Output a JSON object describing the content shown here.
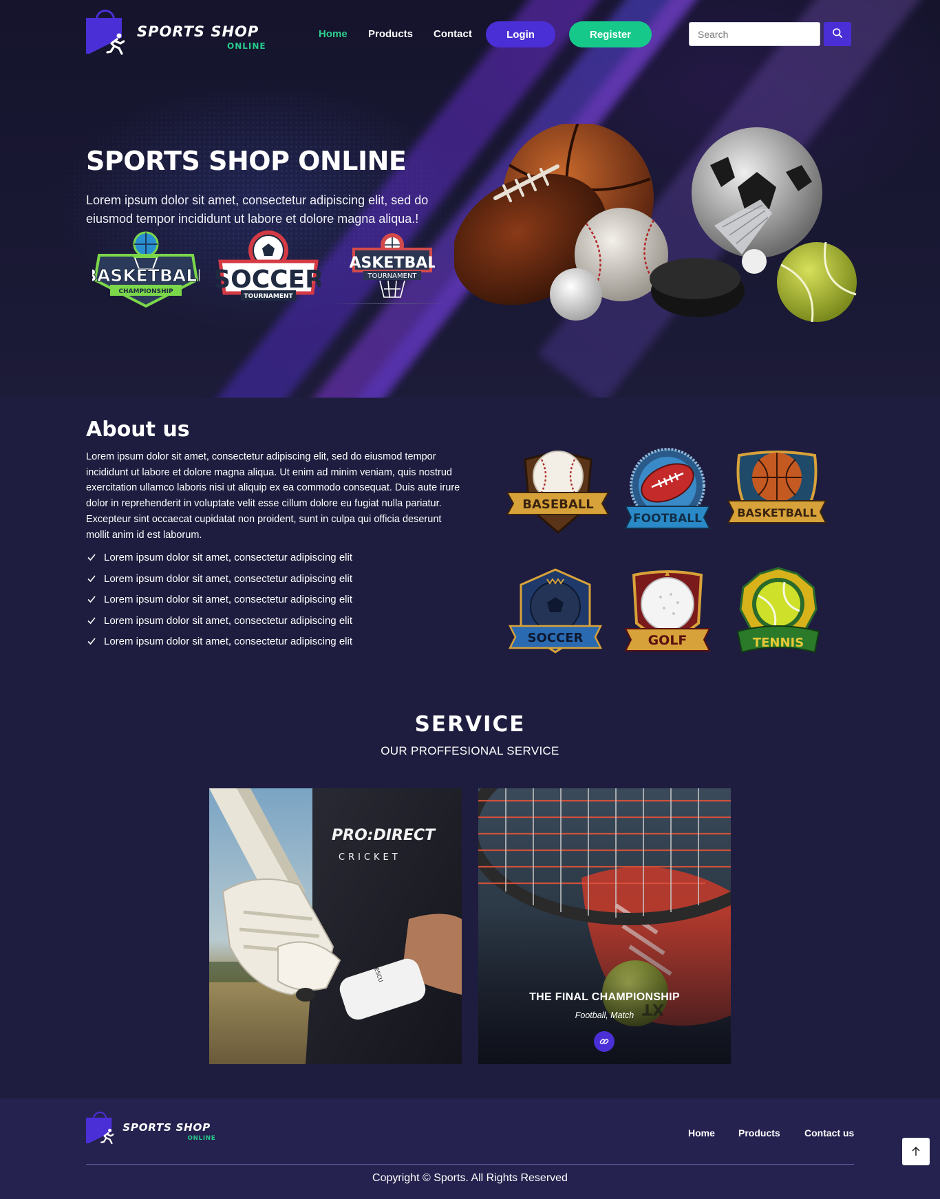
{
  "brand": {
    "name": "SPORTS SHOP",
    "tagline": "ONLINE",
    "accent_color": "#4b2fd6",
    "green_color": "#16c98a",
    "icon": "shopping-bag-runner-icon"
  },
  "nav": {
    "items": [
      {
        "label": "Home",
        "active": true
      },
      {
        "label": "Products",
        "active": false
      },
      {
        "label": "Contact",
        "active": false
      }
    ],
    "login_label": "Login",
    "register_label": "Register",
    "search_placeholder": "Search",
    "search_icon": "search-icon"
  },
  "hero": {
    "title": "SPORTS SHOP ONLINE",
    "text": "Lorem ipsum dolor sit amet, consectetur adipiscing elit, sed do eiusmod tempor incididunt ut labore et dolore magna aliqua.!",
    "logos": [
      {
        "big": "BASKETBALL",
        "small": "CHAMPIONSHIP"
      },
      {
        "big": "SOCCER",
        "small": "TOURNAMENT"
      },
      {
        "big": "BASKETBALL",
        "small": "TOURNAMENT"
      }
    ]
  },
  "about": {
    "title": "About us",
    "text": "Lorem ipsum dolor sit amet, consectetur adipiscing elit, sed do eiusmod tempor incididunt ut labore et dolore magna aliqua. Ut enim ad minim veniam, quis nostrud exercitation ullamco laboris nisi ut aliquip ex ea commodo consequat. Duis aute irure dolor in reprehenderit in voluptate velit esse cillum dolore eu fugiat nulla pariatur. Excepteur sint occaecat cupidatat non proident, sunt in culpa qui officia deserunt mollit anim id est laborum.",
    "checklist": [
      "Lorem ipsum dolor sit amet, consectetur adipiscing elit",
      "Lorem ipsum dolor sit amet, consectetur adipiscing elit",
      "Lorem ipsum dolor sit amet, consectetur adipiscing elit",
      "Lorem ipsum dolor sit amet, consectetur adipiscing elit",
      "Lorem ipsum dolor sit amet, consectetur adipiscing elit"
    ],
    "emblems": [
      "BASEBALL",
      "FOOTBALL",
      "BASKETBALL",
      "SOCCER",
      "GOLF",
      "TENNIS"
    ]
  },
  "service": {
    "title": "SERVICE",
    "subtitle": "OUR PROFFESIONAL SERVICE",
    "cards": [
      {
        "shirt_line1": "PRO:DIRECT",
        "shirt_line2": "CRICKET",
        "sleeve": "ESCU"
      },
      {
        "title": "THE FINAL CHAMPIONSHIP",
        "meta": "Football, Match",
        "ball_text": "XT",
        "link_icon": "link-icon"
      }
    ]
  },
  "footer": {
    "brand_name": "SPORTS SHOP",
    "brand_tagline": "ONLINE",
    "links": [
      "Home",
      "Products",
      "Contact us"
    ],
    "copyright": "Copyright © Sports. All Rights Reserved",
    "to_top_icon": "arrow-up-icon"
  }
}
